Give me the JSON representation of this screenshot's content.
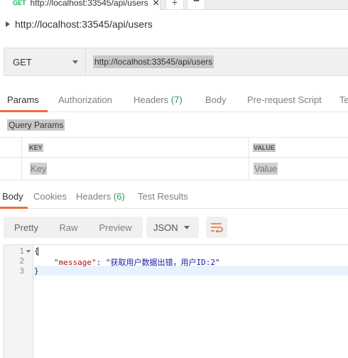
{
  "request_tab": {
    "method": "GET",
    "url": "http://localhost:33545/api/users",
    "close": "✕"
  },
  "tab_actions": {
    "add": "+",
    "more": "•••"
  },
  "request_title": "http://localhost:33545/api/users",
  "request_bar": {
    "method": "GET",
    "url": "http://localhost:33545/api/users"
  },
  "param_tabs": {
    "params": "Params",
    "authorization": "Authorization",
    "headers": "Headers",
    "headers_count": "(7)",
    "body": "Body",
    "prerequest": "Pre-request Script",
    "tests": "Tests"
  },
  "query_params": {
    "label": "Query Params",
    "col_key": "KEY",
    "col_value": "VALUE",
    "key_placeholder": "Key",
    "value_placeholder": "Value"
  },
  "response_tabs": {
    "body": "Body",
    "cookies": "Cookies",
    "headers": "Headers",
    "headers_count": "(6)",
    "test_results": "Test Results"
  },
  "response_toolbar": {
    "pretty": "Pretty",
    "raw": "Raw",
    "preview": "Preview",
    "format": "JSON"
  },
  "editor": {
    "line_numbers": [
      "1",
      "2",
      "3"
    ],
    "line1": "{",
    "line2_key": "\"message\"",
    "line2_sep": ": ",
    "line2_value": "\"获取用户数据出错，用户ID:2\"",
    "line3": "}"
  },
  "colors": {
    "accent": "#f26b3a",
    "method_get": "#0cbb52",
    "count": "#2b9b5c"
  }
}
